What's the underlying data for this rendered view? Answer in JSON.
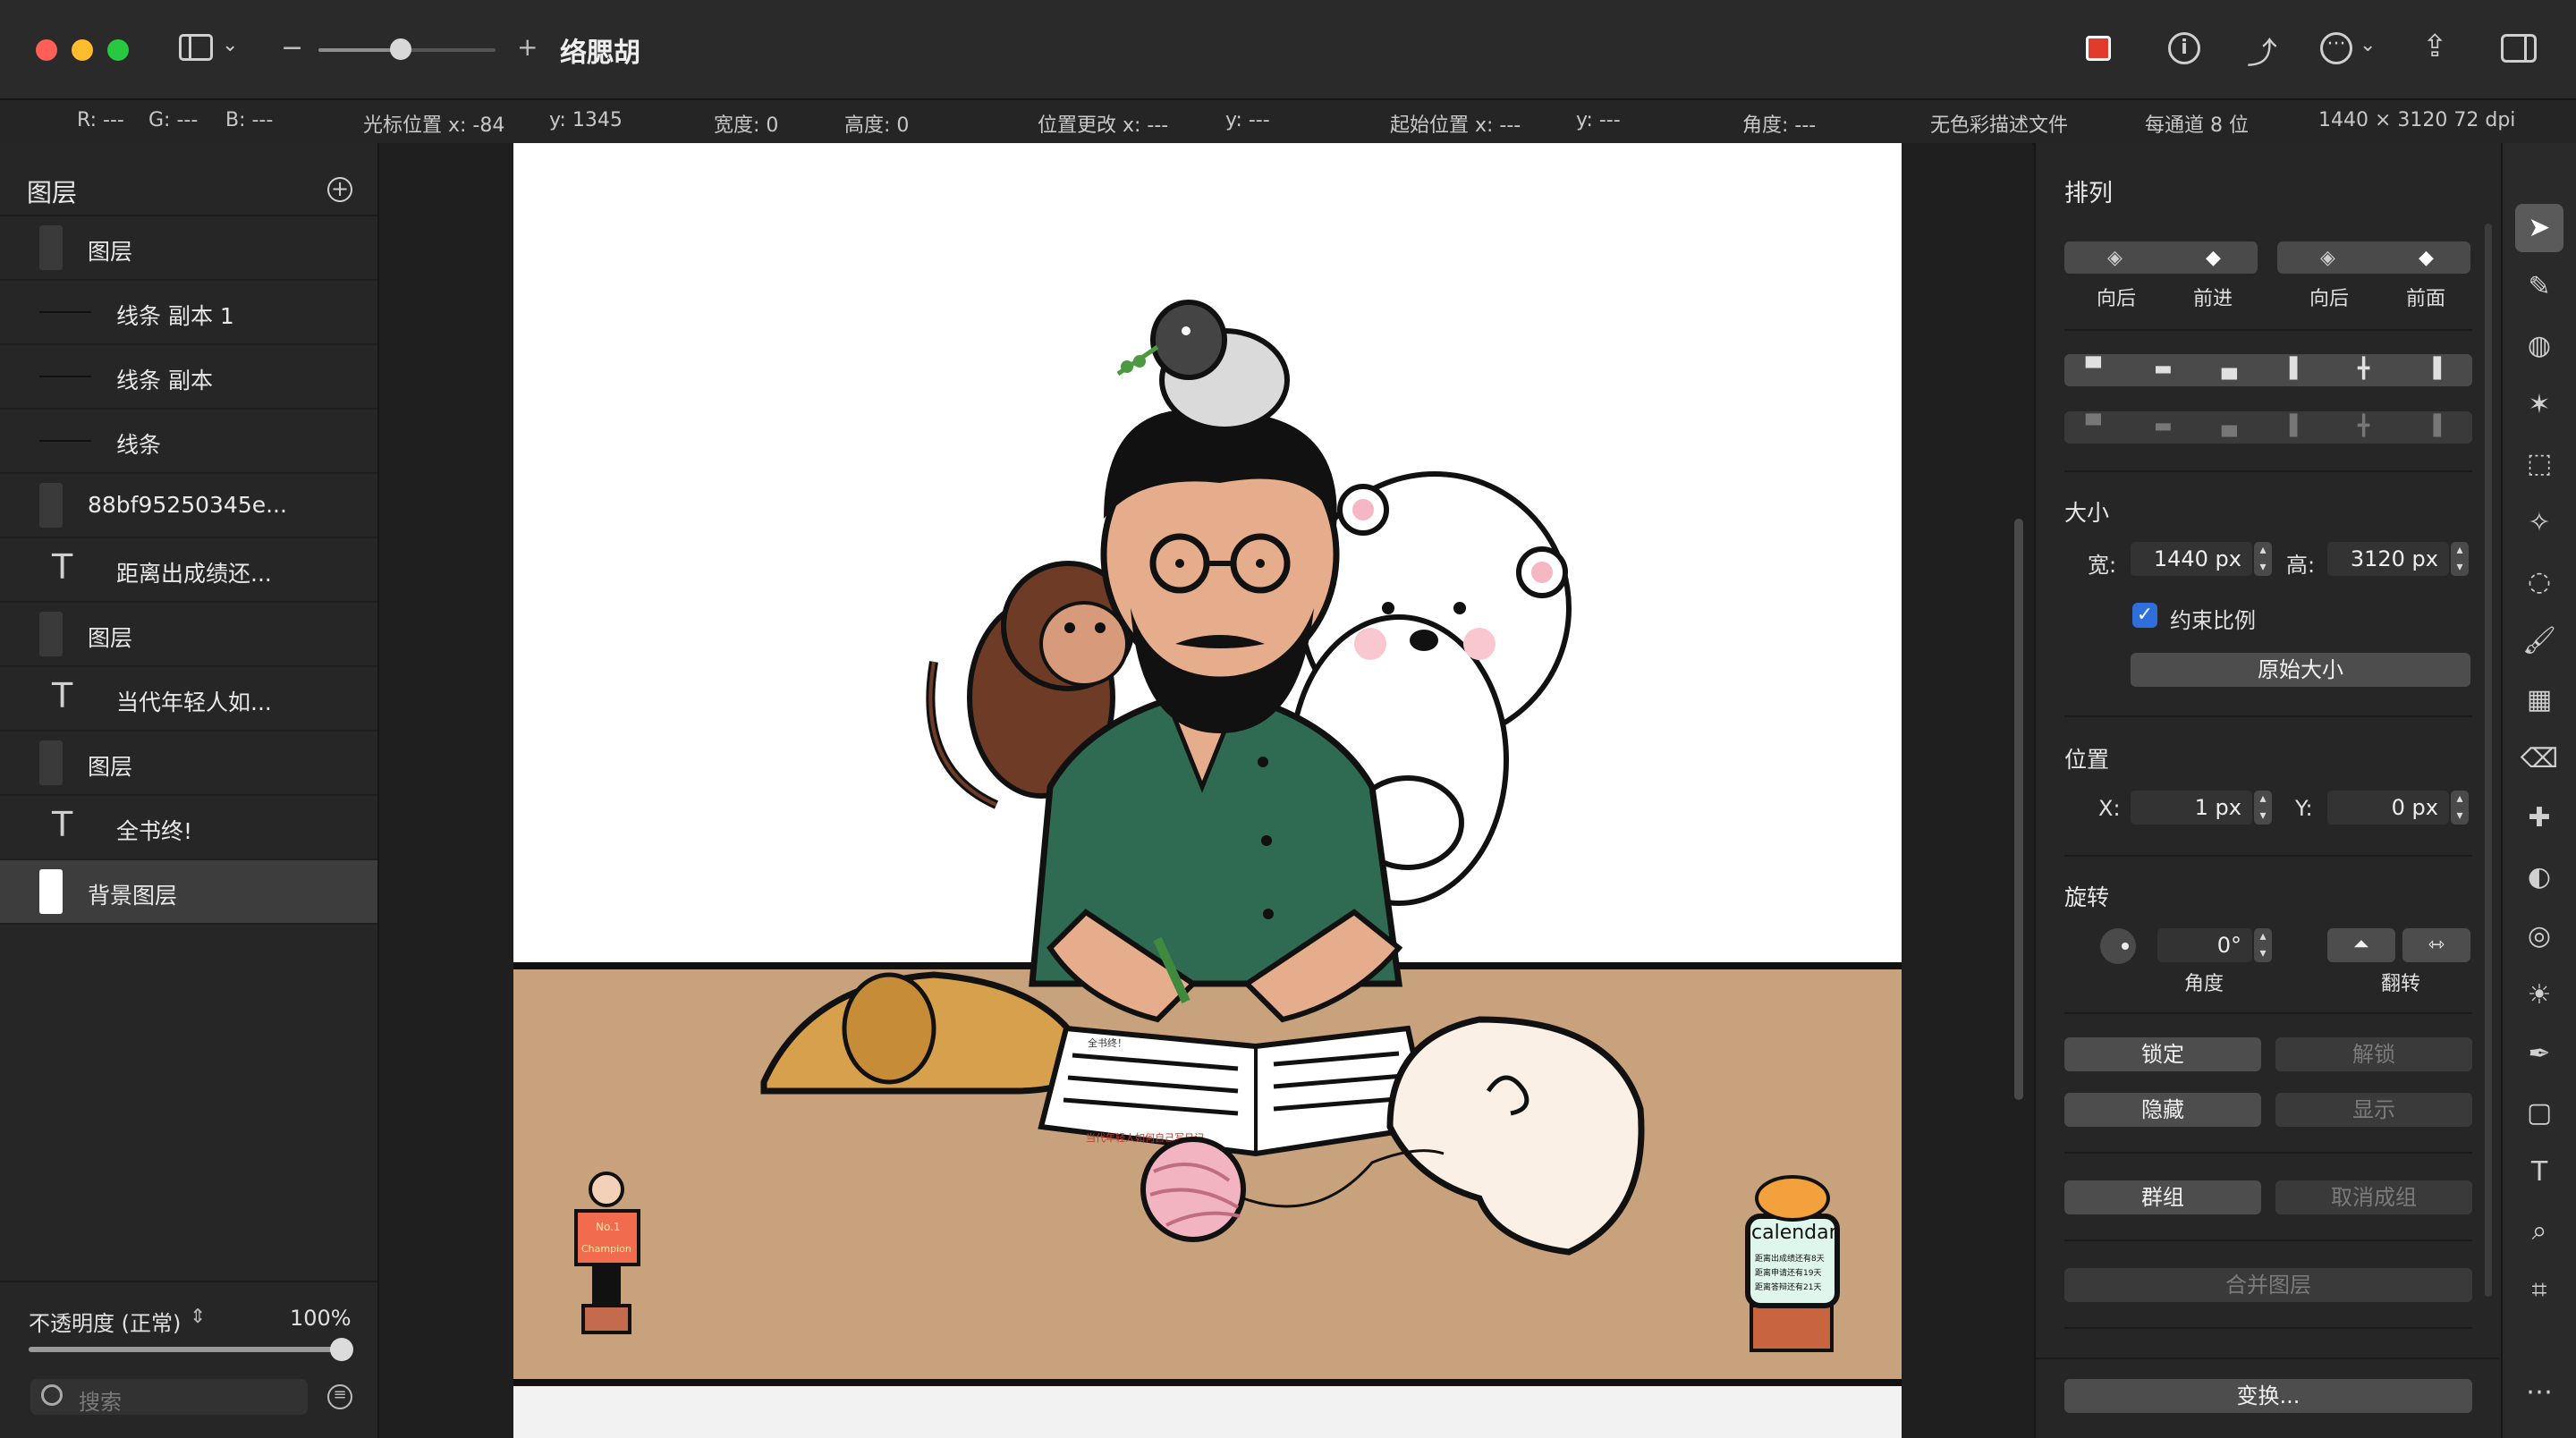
{
  "window": {
    "title": "络腮胡",
    "zoom_slider_fraction": 0.45
  },
  "toolbar": {
    "zoom_minus": "−",
    "zoom_plus": "+"
  },
  "infobar": {
    "rgb_r": "R: ---",
    "rgb_g": "G: ---",
    "rgb_b": "B: ---",
    "cursor_x": "光标位置 x: -84",
    "cursor_y": "y: 1345",
    "width": "宽度: 0",
    "height": "高度: 0",
    "pos_change_x": "位置更改 x: ---",
    "pos_change_y": "y: ---",
    "origin_x": "起始位置 x: ---",
    "origin_y": "y: ---",
    "angle": "角度: ---",
    "color_profile": "无色彩描述文件",
    "bits": "每通道 8 位",
    "dimensions": "1440 × 3120 72 dpi"
  },
  "layers_panel": {
    "title": "图层",
    "layers": [
      {
        "label": "图层",
        "kind": "image"
      },
      {
        "label": "线条 副本 1",
        "kind": "line"
      },
      {
        "label": "线条 副本",
        "kind": "line"
      },
      {
        "label": "线条",
        "kind": "line"
      },
      {
        "label": "88bf95250345e...",
        "kind": "image"
      },
      {
        "label": "距离出成绩还...",
        "kind": "text"
      },
      {
        "label": "图层",
        "kind": "image"
      },
      {
        "label": "当代年轻人如...",
        "kind": "text"
      },
      {
        "label": "图层",
        "kind": "image"
      },
      {
        "label": "全书终!",
        "kind": "text"
      },
      {
        "label": "背景图层",
        "kind": "image",
        "selected": true
      }
    ],
    "opacity_label": "不透明度 (正常)",
    "opacity_value": "100%",
    "opacity_fraction": 1.0,
    "search_placeholder": "搜索"
  },
  "arrange_panel": {
    "title": "排列",
    "order_buttons": [
      "向后",
      "前进",
      "向后",
      "前面"
    ],
    "size_title": "大小",
    "width_label": "宽:",
    "width_value": "1440 px",
    "height_label": "高:",
    "height_value": "3120 px",
    "constrain_label": "约束比例",
    "constrain_checked": true,
    "original_size_button": "原始大小",
    "position_title": "位置",
    "x_label": "X:",
    "x_value": "1 px",
    "y_label": "Y:",
    "y_value": "0 px",
    "rotate_title": "旋转",
    "angle_value": "0°",
    "angle_label": "角度",
    "flip_label": "翻转",
    "lock_button": "锁定",
    "unlock_button": "解锁",
    "hide_button": "隐藏",
    "show_button": "显示",
    "group_button": "群组",
    "ungroup_button": "取消成组",
    "merge_button": "合并图层",
    "transform_button": "变换..."
  },
  "artwork": {
    "book_header": "全书终！",
    "book_footer": "当代年轻人如何自己写日记",
    "figurine_badge": "No.1",
    "figurine_text": "Champion",
    "calendar_title": "calendar",
    "calendar_lines": [
      "距离出成绩还有8天",
      "距离申请还有19天",
      "距离答辩还有21天"
    ]
  },
  "colors": {
    "accent_blue": "#2f6fdc",
    "close": "#ff5f57",
    "minimize": "#febc2e",
    "maximize": "#28c840",
    "shirt": "#2f6b52",
    "table": "#c7a27c",
    "skin": "#e6ad8c"
  }
}
